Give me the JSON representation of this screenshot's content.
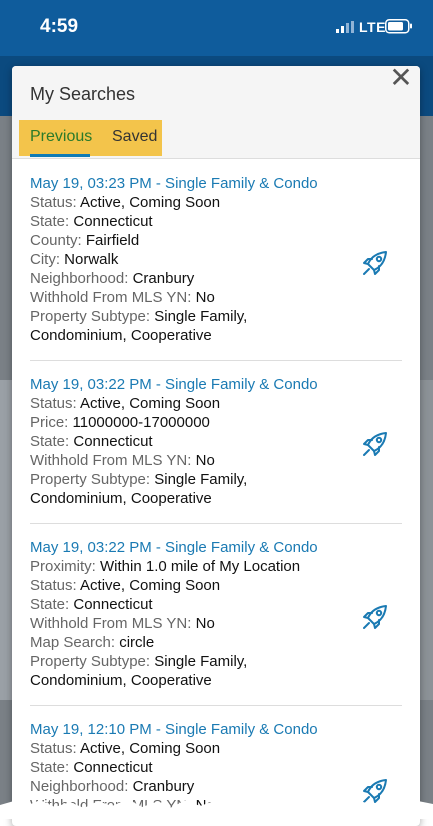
{
  "status_bar": {
    "time": "4:59",
    "network": "LTE"
  },
  "modal": {
    "title": "My Searches",
    "close_label": "✕",
    "tabs": [
      {
        "label": "Previous"
      },
      {
        "label": "Saved"
      }
    ]
  },
  "searches": [
    {
      "title": "May 19, 03:23 PM - Single Family & Condo",
      "fields": [
        {
          "label": "Status:",
          "value": "Active, Coming Soon"
        },
        {
          "label": "State:",
          "value": "Connecticut"
        },
        {
          "label": "County:",
          "value": "Fairfield"
        },
        {
          "label": "City:",
          "value": "Norwalk"
        },
        {
          "label": "Neighborhood:",
          "value": "Cranbury"
        },
        {
          "label": "Withhold From MLS YN:",
          "value": "No"
        },
        {
          "label": "Property Subtype:",
          "value": "Single Family,"
        },
        {
          "label": "",
          "value": "Condominium, Cooperative"
        }
      ]
    },
    {
      "title": "May 19, 03:22 PM - Single Family & Condo",
      "fields": [
        {
          "label": "Status:",
          "value": "Active, Coming Soon"
        },
        {
          "label": "Price:",
          "value": "11000000-17000000"
        },
        {
          "label": "State:",
          "value": "Connecticut"
        },
        {
          "label": "Withhold From MLS YN:",
          "value": "No"
        },
        {
          "label": "Property Subtype:",
          "value": "Single Family,"
        },
        {
          "label": "",
          "value": "Condominium, Cooperative"
        }
      ]
    },
    {
      "title": "May 19, 03:22 PM - Single Family & Condo",
      "fields": [
        {
          "label": "Proximity:",
          "value": "Within 1.0 mile of My Location"
        },
        {
          "label": "Status:",
          "value": "Active, Coming Soon"
        },
        {
          "label": "State:",
          "value": "Connecticut"
        },
        {
          "label": "Withhold From MLS YN:",
          "value": "No"
        },
        {
          "label": "Map Search:",
          "value": "circle"
        },
        {
          "label": "Property Subtype:",
          "value": "Single Family,"
        },
        {
          "label": "",
          "value": "Condominium, Cooperative"
        }
      ]
    },
    {
      "title": "May 19, 12:10 PM - Single Family & Condo",
      "fields": [
        {
          "label": "Status:",
          "value": "Active, Coming Soon"
        },
        {
          "label": "State:",
          "value": "Connecticut"
        },
        {
          "label": "Neighborhood:",
          "value": "Cranbury"
        },
        {
          "label": "Withhold From MLS YN:",
          "value": "No"
        }
      ]
    }
  ],
  "icons": {
    "run_search": "rocket-icon"
  },
  "colors": {
    "accent": "#1a7ab3",
    "tab_highlight": "#f3c44b",
    "status_bar": "#0f5c9c"
  }
}
